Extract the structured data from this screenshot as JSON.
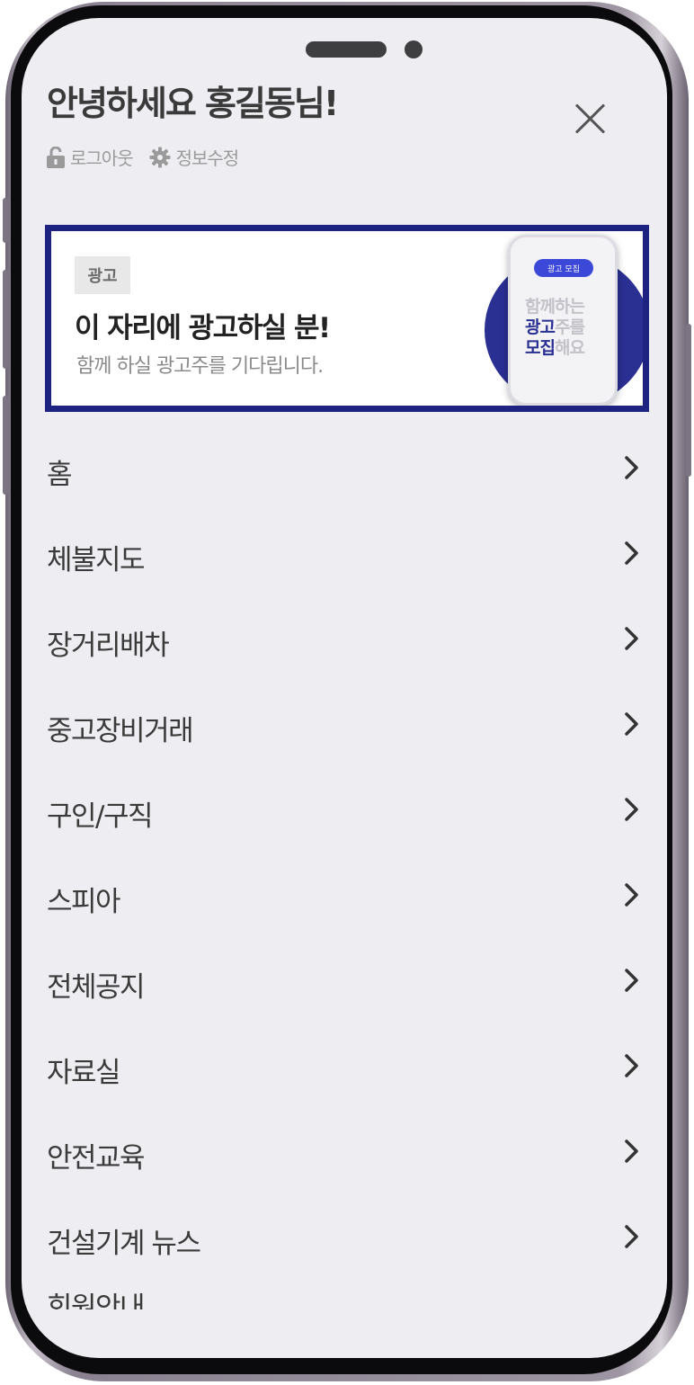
{
  "header": {
    "greeting": "안녕하세요 홍길동님!",
    "logout_label": "로그아웃",
    "edit_profile_label": "정보수정"
  },
  "ad": {
    "badge": "광고",
    "headline": "이 자리에 광고하실 분!",
    "subtext": "함께 하실 광고주를 기다립니다.",
    "graphic_pill": "광고 모집",
    "graphic_line1_light": "함께하는",
    "graphic_line2_dark": "광고",
    "graphic_line2_light": "주를",
    "graphic_line3_dark": "모집",
    "graphic_line3_light": "해요",
    "border_color": "#1e2280"
  },
  "menu": {
    "items": [
      {
        "label": "홈"
      },
      {
        "label": "체불지도"
      },
      {
        "label": "장거리배차"
      },
      {
        "label": "중고장비거래"
      },
      {
        "label": "구인/구직"
      },
      {
        "label": "스피아"
      },
      {
        "label": "전체공지"
      },
      {
        "label": "자료실"
      },
      {
        "label": "안전교육"
      },
      {
        "label": "건설기계 뉴스"
      }
    ],
    "partial_item": "회원안내"
  },
  "icons": [
    "lock-open-icon",
    "gear-icon",
    "close-icon",
    "chevron-right-icon"
  ],
  "colors": {
    "screen_bg": "#eeedf1",
    "text": "#3a3a3a",
    "muted": "#9a9a9a",
    "ad_accent": "#2a2f92"
  }
}
